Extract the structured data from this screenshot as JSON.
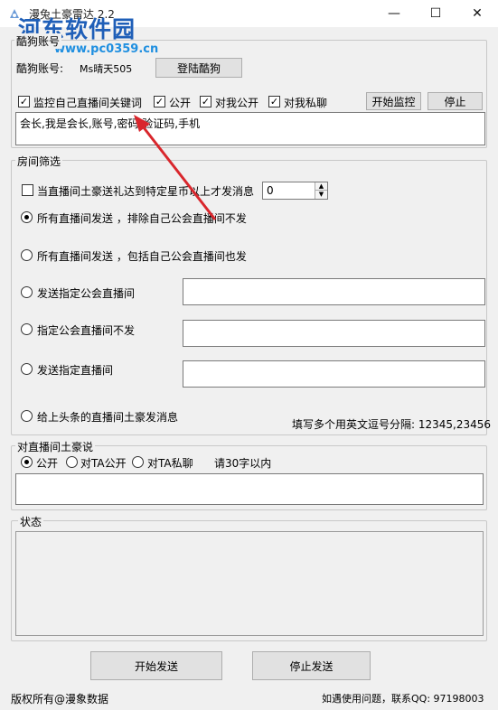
{
  "window": {
    "title": "漫兔土豪雷达 2.2",
    "minimize": "—",
    "maximize": "☐",
    "close": "✕",
    "watermark_logo": "河东软件园",
    "watermark_url": "www.pc0359.cn"
  },
  "account": {
    "group_label": "酷狗账号",
    "label": "酷狗账号:",
    "value": "Ms晴天505",
    "login_button": "登陆酷狗"
  },
  "monitor": {
    "keyword_check": {
      "label": "监控自己直播间关键词",
      "checked": true
    },
    "public_check": {
      "label": "公开",
      "checked": true
    },
    "to_me_public_check": {
      "label": "对我公开",
      "checked": true
    },
    "to_me_private_check": {
      "label": "对我私聊",
      "checked": true
    },
    "start_button": "开始监控",
    "stop_button": "停止",
    "keywords_text": "会长,我是会长,账号,密码,验证码,手机"
  },
  "room_filter": {
    "group_label": "房间筛选",
    "threshold_check": {
      "label": "当直播间土豪送礼达到特定星币以上才发消息",
      "checked": false
    },
    "threshold_value": "0",
    "options": [
      {
        "label": "所有直播间发送 ，排除自己公会直播间不发",
        "selected": true
      },
      {
        "label": "所有直播间发送 ，包括自己公会直播间也发",
        "selected": false
      },
      {
        "label": "发送指定公会直播间",
        "selected": false,
        "value": ""
      },
      {
        "label": "指定公会直播间不发",
        "selected": false,
        "value": ""
      },
      {
        "label": "发送指定直播间",
        "selected": false,
        "value": ""
      },
      {
        "label": "给上头条的直播间土豪发消息",
        "selected": false
      }
    ],
    "hint": "填写多个用英文逗号分隔: 12345,23456"
  },
  "message": {
    "group_label": "对直播间土豪说",
    "modes": [
      {
        "label": "公开",
        "selected": true
      },
      {
        "label": "对TA公开",
        "selected": false
      },
      {
        "label": "对TA私聊",
        "selected": false
      }
    ],
    "limit_hint": "请30字以内",
    "text": ""
  },
  "status": {
    "group_label": "状态",
    "text": ""
  },
  "actions": {
    "start_send": "开始发送",
    "stop_send": "停止发送"
  },
  "footer": {
    "copyright": "版权所有@漫象数据",
    "contact": "如遇使用问题，联系QQ: 97198003"
  },
  "colors": {
    "window_bg": "#f0f0f0",
    "watermark_blue": "#1f5fb8",
    "arrow_red": "#d9262c"
  }
}
